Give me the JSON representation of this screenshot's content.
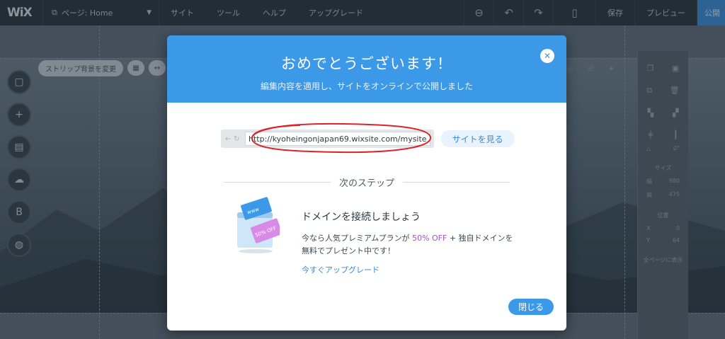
{
  "topbar": {
    "logo": "WiX",
    "page_selector": "ページ: Home",
    "menu": [
      "サイト",
      "ツール",
      "ヘルプ",
      "アップグレード"
    ],
    "save": "保存",
    "preview": "プレビュー",
    "publish": "公開"
  },
  "editor": {
    "strip_button": "ストリップ背景を変更",
    "right_panel": {
      "size_label": "サイズ",
      "width_label": "幅",
      "width_value": "980",
      "height_label": "高",
      "height_value": "475",
      "position_label": "位置",
      "x_label": "X",
      "x_value": "0",
      "y_label": "Y",
      "y_value": "64",
      "show_all_label": "全ページに表示",
      "rotation_value": "0°"
    }
  },
  "dialog": {
    "title": "おめでとうございます！",
    "subtitle": "編集内容を適用し、サイトをオンラインで公開しました",
    "url": "http://kyoheingonjapan69.wixsite.com/mysite",
    "view_site": "サイトを見る",
    "next_steps": "次のステップ",
    "promo": {
      "badge": "50% OFF",
      "title": "ドメインを接続しましょう",
      "text_before": "今なら人気プレミアムプランが ",
      "discount": "50% OFF",
      "text_after": " + 独自ドメインを無料でプレゼント中です！",
      "link": "今すぐアップグレード"
    },
    "close": "閉じる"
  },
  "colors": {
    "accent": "#3b99e8",
    "promo_purple": "#a54fd1",
    "annotation_red": "#d9242b"
  }
}
